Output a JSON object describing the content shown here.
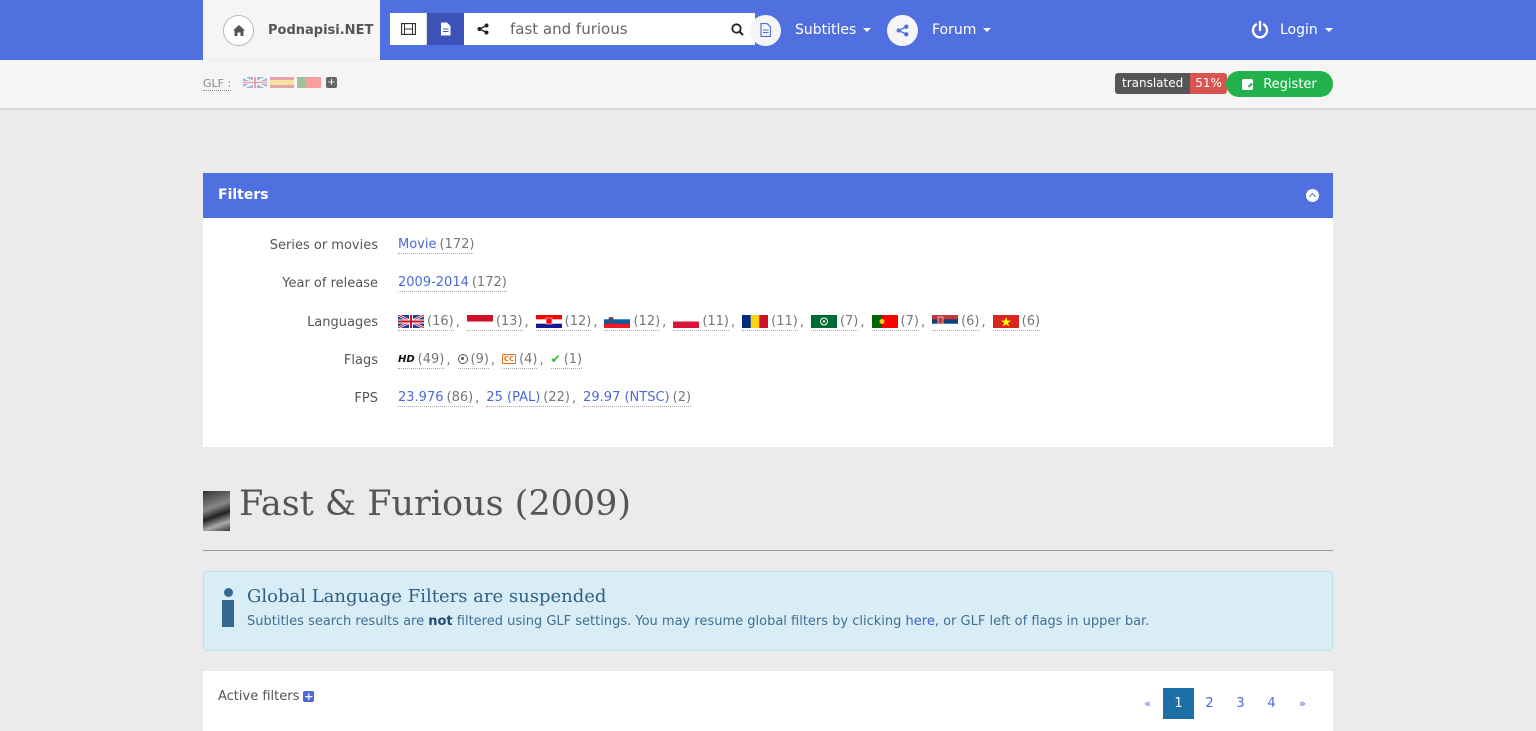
{
  "brand": {
    "name": "Podnapisi.NET"
  },
  "search": {
    "value": "fast and furious",
    "placeholder": ""
  },
  "nav": {
    "subtitles": "Subtitles",
    "forum": "Forum",
    "login": "Login"
  },
  "subbar": {
    "glf_label": "GLF :",
    "translated_label": "translated",
    "translated_pct": "51%",
    "register_label": "Register"
  },
  "filters": {
    "title": "Filters",
    "series": {
      "label": "Series or movies",
      "value": "Movie",
      "count": "(172)"
    },
    "year": {
      "label": "Year of release",
      "value": "2009-2014",
      "count": "(172)"
    },
    "languages": {
      "label": "Languages",
      "items": [
        {
          "icon": "flag-uk-icon",
          "count": "(16)"
        },
        {
          "icon": "flag-id-icon",
          "count": "(13)"
        },
        {
          "icon": "flag-hr-icon",
          "count": "(12)"
        },
        {
          "icon": "flag-si-icon",
          "count": "(12)"
        },
        {
          "icon": "flag-pl-icon",
          "count": "(11)"
        },
        {
          "icon": "flag-ro-icon",
          "count": "(11)"
        },
        {
          "icon": "flag-ar-icon",
          "count": "(7)"
        },
        {
          "icon": "flag-pt-icon",
          "count": "(7)"
        },
        {
          "icon": "flag-rs-icon",
          "count": "(6)"
        },
        {
          "icon": "flag-vn-icon",
          "count": "(6)"
        }
      ]
    },
    "flags": {
      "label": "Flags",
      "hd": "HD",
      "hd_count": "(49)",
      "hi_count": "(9)",
      "cc": "CC",
      "cc_count": "(4)",
      "ok_count": "(1)"
    },
    "fps": {
      "label": "FPS",
      "items": [
        {
          "value": "23.976",
          "count": "(86)"
        },
        {
          "value": "25 (PAL)",
          "count": "(22)"
        },
        {
          "value": "29.97 (NTSC)",
          "count": "(2)"
        }
      ]
    }
  },
  "movie": {
    "title": "Fast & Furious (2009)"
  },
  "alert": {
    "title": "Global Language Filters are suspended",
    "text_1": "Subtitles search results are ",
    "text_bold": "not",
    "text_2": " filtered using GLF settings. You may resume global filters by clicking ",
    "text_link": "here",
    "text_3": ", or GLF left of flags in upper bar."
  },
  "active_filters": {
    "label": "Active filters",
    "pager": {
      "prev": "«",
      "pages": [
        "1",
        "2",
        "3",
        "4"
      ],
      "next": "»",
      "current": "1"
    }
  }
}
